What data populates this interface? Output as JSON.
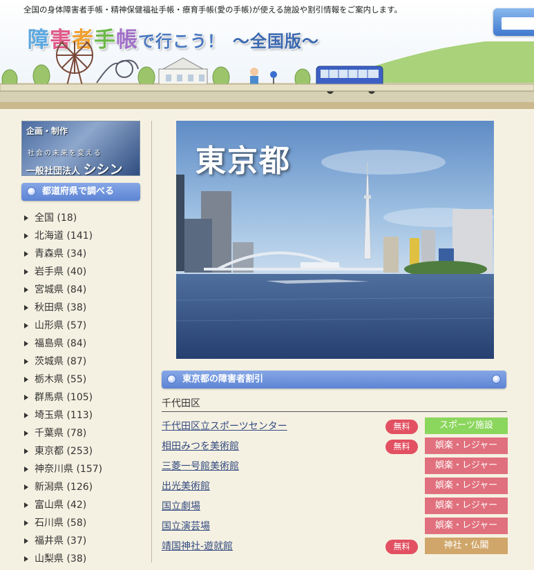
{
  "header": {
    "tagline": "全国の身体障害者手帳・精神保健福祉手帳・療育手帳(愛の手帳)が使える施設や割引情報をご案内します。",
    "title_chars": [
      "障",
      "害",
      "者",
      "手",
      "帳"
    ],
    "title_rest": "で行こう！",
    "title_version": "～全国版～"
  },
  "sidebar": {
    "banner": {
      "line1": "企画・制作",
      "line2": "社会の未来を変える",
      "line3_small": "一般社団法人",
      "line3_big": "シシン"
    },
    "pref_header": "都道府県で調べる",
    "prefectures": [
      "全国 (18)",
      "北海道 (141)",
      "青森県 (34)",
      "岩手県 (40)",
      "宮城県 (84)",
      "秋田県 (38)",
      "山形県 (57)",
      "福島県 (84)",
      "茨城県 (87)",
      "栃木県 (55)",
      "群馬県 (105)",
      "埼玉県 (113)",
      "千葉県 (78)",
      "東京都 (253)",
      "神奈川県 (157)",
      "新潟県 (126)",
      "富山県 (42)",
      "石川県 (58)",
      "福井県 (37)",
      "山梨県 (38)"
    ]
  },
  "main": {
    "hero_title": "東京都",
    "discount_header": "東京都の障害者割引",
    "area_label": "千代田区",
    "facilities": [
      {
        "name": "千代田区立スポーツセンター",
        "free": "無料",
        "category": "スポーツ施設",
        "cat_type": "sports"
      },
      {
        "name": "相田みつを美術館",
        "free": "無料",
        "category": "娯楽・レジャー",
        "cat_type": "leisure"
      },
      {
        "name": "三菱一号館美術館",
        "free": null,
        "category": "娯楽・レジャー",
        "cat_type": "leisure"
      },
      {
        "name": "出光美術館",
        "free": null,
        "category": "娯楽・レジャー",
        "cat_type": "leisure"
      },
      {
        "name": "国立劇場",
        "free": null,
        "category": "娯楽・レジャー",
        "cat_type": "leisure"
      },
      {
        "name": "国立演芸場",
        "free": null,
        "category": "娯楽・レジャー",
        "cat_type": "leisure"
      },
      {
        "name": "靖国神社-遊就館",
        "free": "無料",
        "category": "神社・仏閣",
        "cat_type": "shrine"
      }
    ]
  },
  "colors": {
    "section_header": "#6f92dc",
    "free_badge": "#e25061",
    "cat_sports": "#8bd65c",
    "cat_leisure": "#e0707d",
    "cat_shrine": "#d0a66a",
    "background": "#f5f1e2"
  }
}
